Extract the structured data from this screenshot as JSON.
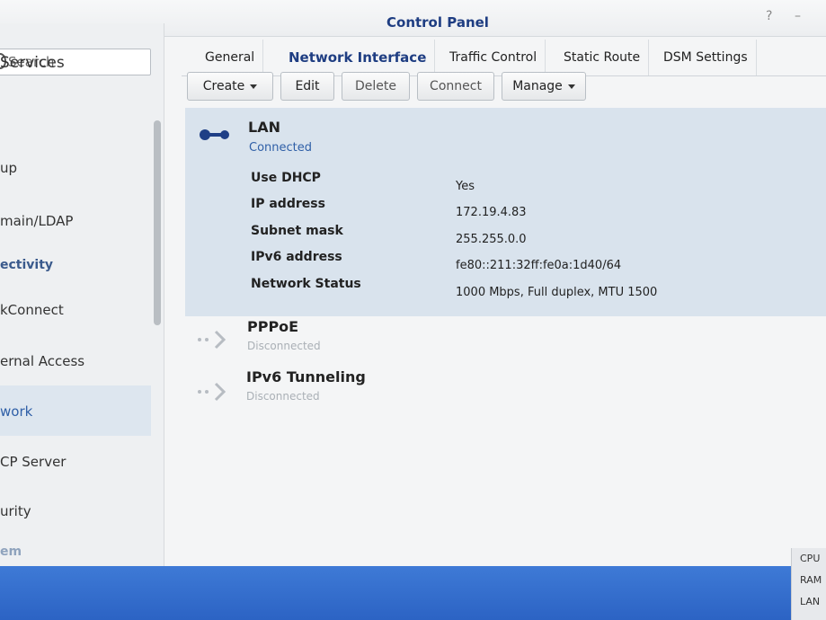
{
  "window": {
    "title": "Control Panel",
    "help_label": "?",
    "minimize_label": "–"
  },
  "sidebar": {
    "search_placeholder": "Search",
    "items": [
      {
        "label": "Services"
      },
      {
        "label": "up"
      },
      {
        "label": "main/LDAP"
      },
      {
        "label": "ectivity"
      },
      {
        "label": "kConnect"
      },
      {
        "label": "ernal Access"
      },
      {
        "label": "work"
      },
      {
        "label": "CP Server"
      },
      {
        "label": "urity"
      },
      {
        "label": "em"
      }
    ]
  },
  "tabs": [
    {
      "label": "General"
    },
    {
      "label": "Network Interface"
    },
    {
      "label": "Traffic Control"
    },
    {
      "label": "Static Route"
    },
    {
      "label": "DSM Settings"
    }
  ],
  "toolbar": {
    "create": "Create",
    "edit": "Edit",
    "delete": "Delete",
    "connect": "Connect",
    "manage": "Manage"
  },
  "interfaces": {
    "lan": {
      "name": "LAN",
      "status": "Connected",
      "details": [
        {
          "label": "Use DHCP",
          "value": "Yes"
        },
        {
          "label": "IP address",
          "value": "172.19.4.83"
        },
        {
          "label": "Subnet mask",
          "value": "255.255.0.0"
        },
        {
          "label": "IPv6 address",
          "value": "fe80::211:32ff:fe0a:1d40/64"
        },
        {
          "label": "Network Status",
          "value": "1000 Mbps, Full duplex, MTU 1500"
        }
      ]
    },
    "pppoe": {
      "name": "PPPoE",
      "status": "Disconnected"
    },
    "ipv6": {
      "name": "IPv6 Tunneling",
      "status": "Disconnected"
    }
  },
  "resource_widget": {
    "cpu": "CPU",
    "ram": "RAM",
    "lan": "LAN"
  },
  "colors": {
    "accent": "#1e3d82",
    "connected": "#2f5fa7",
    "selected_row": "#d9e3ed",
    "taskbar": "#2c63c4"
  },
  "icons": {
    "lan": "ethernet-plug-icon",
    "pppoe": "dotted-arrow-icon",
    "ipv6": "dotted-arrow-icon"
  }
}
